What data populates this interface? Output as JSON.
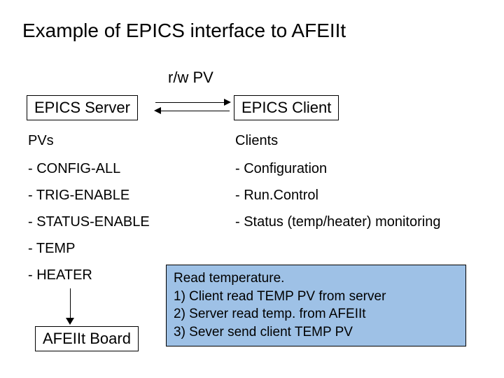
{
  "title": "Example of EPICS interface to AFEIIt",
  "rw_label": "r/w PV",
  "server_box": "EPICS Server",
  "client_box": "EPICS Client",
  "left": {
    "heading": "PVs",
    "items": [
      "- CONFIG-ALL",
      "- TRIG-ENABLE",
      "- STATUS-ENABLE",
      "- TEMP",
      "- HEATER"
    ]
  },
  "right": {
    "heading": "Clients",
    "items": [
      "- Configuration",
      "- Run.Control",
      "- Status (temp/heater) monitoring"
    ]
  },
  "afeiit_box": "AFEIIt Board",
  "note": {
    "line0": "Read temperature.",
    "line1": "1) Client read TEMP PV from server",
    "line2": "2) Server read temp. from AFEIIt",
    "line3": "3) Sever send client TEMP PV"
  }
}
